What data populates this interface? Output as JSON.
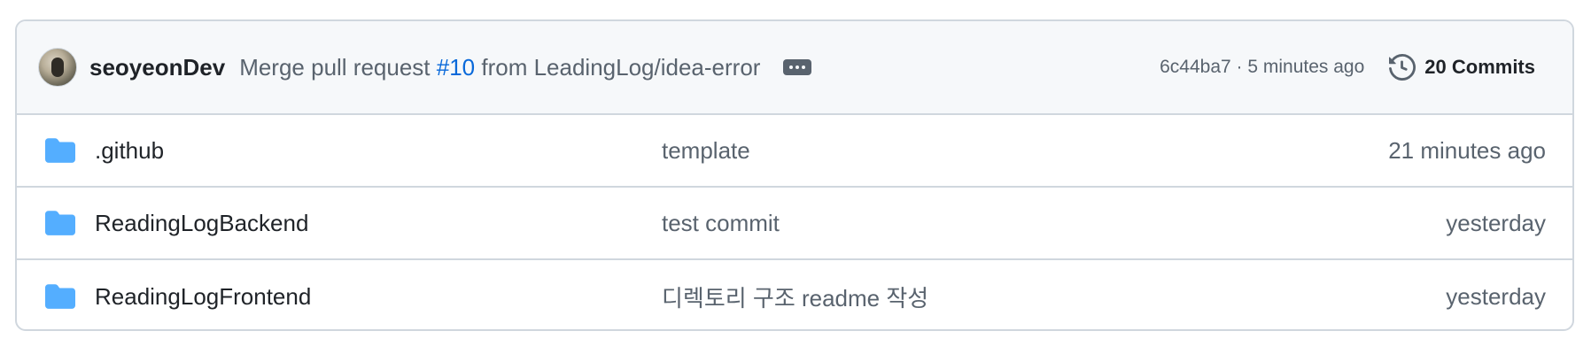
{
  "latest_commit": {
    "author": "seoyeonDev",
    "message_prefix": "Merge pull request ",
    "pr_link": "#10",
    "message_suffix": " from LeadingLog/idea-error",
    "hash_time": "6c44ba7 · 5 minutes ago",
    "commits_label": "20 Commits"
  },
  "files": [
    {
      "name": ".github",
      "message": "template",
      "time": "21 minutes ago",
      "icon": "folder-icon"
    },
    {
      "name": "ReadingLogBackend",
      "message": "test commit",
      "time": "yesterday",
      "icon": "folder-icon"
    },
    {
      "name": "ReadingLogFrontend",
      "message": "디렉토리 구조 readme 작성",
      "time": "yesterday",
      "icon": "folder-icon"
    }
  ],
  "colors": {
    "folder": "#54aeff",
    "link": "#0969da",
    "muted": "#59636e",
    "border": "#d0d7de",
    "header_bg": "#f6f8fa"
  }
}
